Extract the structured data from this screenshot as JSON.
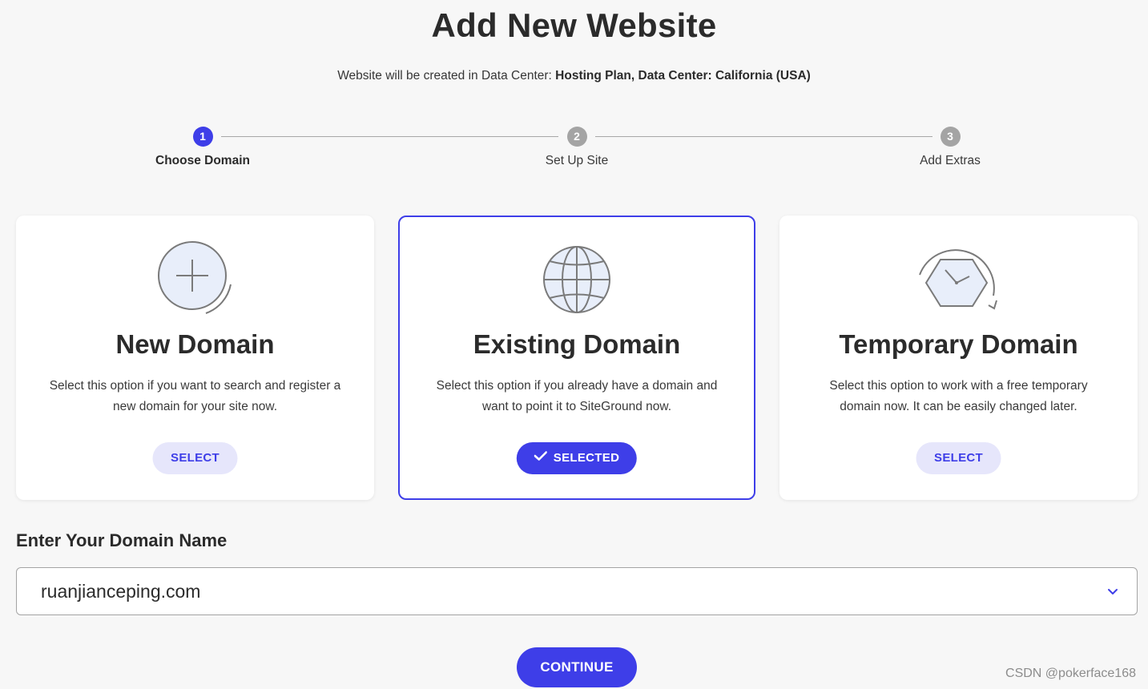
{
  "header": {
    "title": "Add New Website",
    "subtitle_prefix": "Website will be created in Data Center: ",
    "subtitle_bold": "Hosting Plan, Data Center: California (USA)"
  },
  "stepper": {
    "steps": [
      {
        "number": "1",
        "label": "Choose Domain",
        "state": "active"
      },
      {
        "number": "2",
        "label": "Set Up Site",
        "state": "inactive"
      },
      {
        "number": "3",
        "label": "Add Extras",
        "state": "inactive"
      }
    ]
  },
  "cards": [
    {
      "icon": "plus-circle-icon",
      "title": "New Domain",
      "description": "Select this option if you want to search and register a new domain for your site now.",
      "button_label": "SELECT",
      "selected": false
    },
    {
      "icon": "globe-icon",
      "title": "Existing Domain",
      "description": "Select this option if you already have a domain and want to point it to SiteGround now.",
      "button_label": "SELECTED",
      "selected": true
    },
    {
      "icon": "clock-hexagon-icon",
      "title": "Temporary Domain",
      "description": "Select this option to work with a free temporary domain now. It can be easily changed later.",
      "button_label": "SELECT",
      "selected": false
    }
  ],
  "domain": {
    "label": "Enter Your Domain Name",
    "value": "ruanjianceping.com"
  },
  "continue_label": "CONTINUE",
  "watermark": "CSDN @pokerface168",
  "colors": {
    "accent": "#3e3ee8",
    "accent_light": "#e6e6fb",
    "inactive_step": "#a4a4a4",
    "background": "#f7f7f7"
  }
}
